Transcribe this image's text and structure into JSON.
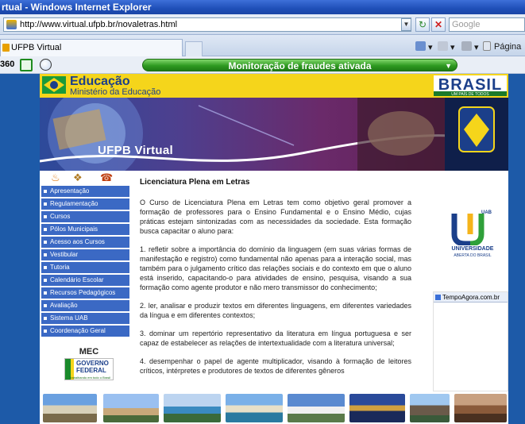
{
  "window": {
    "title": "rtual - Windows Internet Explorer"
  },
  "address": {
    "url": "http://www.virtual.ufpb.br/novaletras.html",
    "search_placeholder": "Google"
  },
  "tab": {
    "label": "UFPB Virtual"
  },
  "commands": {
    "page_label": "Página"
  },
  "toolbar": {
    "left_label": "360",
    "fraud_label": "Monitoração de fraudes ativada"
  },
  "site": {
    "header_title": "Educação",
    "header_subtitle": "Ministério da Educação",
    "brasil_text": "BRASIL",
    "brasil_tagline": "UM PAÍS DE TODOS",
    "banner_title": "UFPB Virtual"
  },
  "menu": [
    "Apresentação",
    "Regulamentação",
    "Cursos",
    "Pólos Municipais",
    "Acesso aos Cursos",
    "Vestibular",
    "Tutoria",
    "Calendário Escolar",
    "Recursos Pedagógicos",
    "Avaliação",
    "Sistema UAB",
    "Coordenação Geral"
  ],
  "mec": {
    "label": "MEC",
    "gov_line1": "GOVERNO",
    "gov_line2": "FEDERAL",
    "gov_sub": "Trabalhando em todo o Brasil"
  },
  "content": {
    "title": "Licenciatura Plena em Letras",
    "paragraphs": [
      "O Curso de Licenciatura Plena em Letras tem como objetivo geral promover a formação de professores para o Ensino Fundamental e o Ensino Médio, cujas práticas estejam sintonizadas com as necessidades da sociedade. Esta formação busca capacitar o aluno para:",
      "1. refletir sobre a importância do domínio da linguagem (em suas várias formas de manifestação e registro) como fundamental não apenas para a interação social, mas também para o julgamento crítico das relações sociais e do contexto em que o aluno está inserido, capacitando-o para atividades de ensino, pesquisa, visando a sua formação como agente produtor e não mero transmissor do conhecimento;",
      "2. ler, analisar e produzir textos em diferentes linguagens, em diferentes variedades da língua e em diferentes contextos;",
      "3. dominar um repertório representativo da literatura em língua portuguesa e ser capaz de estabelecer as relações de intertextualidade com a literatura universal;",
      "4. desempenhar o papel de agente multiplicador, visando à formação de leitores críticos, intérpretes e produtores de textos de diferentes gêneros"
    ]
  },
  "uab": {
    "tag": "UAB",
    "name": "UNIVERSIDADE",
    "sub": "ABERTA DO BRASIL"
  },
  "tempo": {
    "label": "TempoAgora.com.br"
  }
}
